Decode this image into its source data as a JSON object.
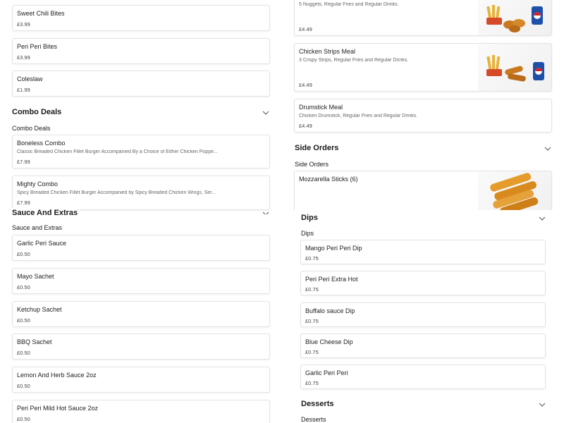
{
  "left": {
    "top_items": [
      {
        "name": "Sweet Chili Bites",
        "price": "£3.99"
      },
      {
        "name": "Peri Peri Bites",
        "price": "£3.99"
      },
      {
        "name": "Coleslaw",
        "price": "£1.99"
      }
    ],
    "combo": {
      "title": "Combo Deals",
      "subtitle": "Combo Deals",
      "items": [
        {
          "name": "Boneless Combo",
          "desc": "Classic Breaded Chicken Fillet Burger Accompanied By a Choice of Either Chicken Poppe...",
          "price": "£7.99"
        },
        {
          "name": "Mighty Combo",
          "desc": "Spicy Breaded Chicken Fillet Burger Accompanied by Spicy Breaded Chicken Wings, Ser...",
          "price": "£7.99"
        }
      ]
    },
    "sauce": {
      "title": "Sauce And Extras",
      "subtitle": "Sauce and Extras",
      "items": [
        {
          "name": "Garlic Peri Sauce",
          "price": "£0.50"
        },
        {
          "name": "Mayo Sachet",
          "price": "£0.50"
        },
        {
          "name": "Ketchup Sachet",
          "price": "£0.50"
        },
        {
          "name": "BBQ Sachet",
          "price": "£0.50"
        },
        {
          "name": "Lemon And Herb Sauce 2oz",
          "price": "£0.50"
        },
        {
          "name": "Peri Peri Mild Hot Sauce 2oz",
          "price": "£0.50"
        }
      ]
    }
  },
  "right": {
    "meals": [
      {
        "name": "",
        "desc": "5 Nuggets, Regular Fries and Regular Drinks.",
        "price": "£4.49"
      },
      {
        "name": "Chicken Strips Meal",
        "desc": "3 Crispy Strips, Regular Fries and Regular Drinks.",
        "price": "£4.49"
      },
      {
        "name": "Drumstick Meal",
        "desc": "Chicken Drumstick, Regular Fries and Regular Drinks.",
        "price": "£4.49"
      }
    ],
    "side": {
      "title": "Side Orders",
      "subtitle": "Side Orders",
      "items": [
        {
          "name": "Mozzarella Sticks (6)"
        }
      ]
    },
    "dips": {
      "title": "Dips",
      "subtitle": "Dips",
      "items": [
        {
          "name": "Mango Peri Peri Dip",
          "price": "£0.75"
        },
        {
          "name": "Peri Peri Extra Hot",
          "price": "£0.75"
        },
        {
          "name": "Buffalo sauce Dip",
          "price": "£0.75"
        },
        {
          "name": "Blue Cheese Dip",
          "price": "£0.75"
        },
        {
          "name": "Garlic Peri Peri",
          "price": "£0.75"
        }
      ]
    },
    "desserts": {
      "title": "Desserts",
      "subtitle": "Desserts"
    }
  },
  "icons": {
    "chevron": "chevron-down-icon",
    "pepsi": "pepsi-can-icon"
  },
  "colors": {
    "chevron": "#666666",
    "fries": "#e8b23a",
    "chicken": "#c9781f",
    "pepsi_blue": "#1f4fa8",
    "pepsi_red": "#d2232a"
  }
}
